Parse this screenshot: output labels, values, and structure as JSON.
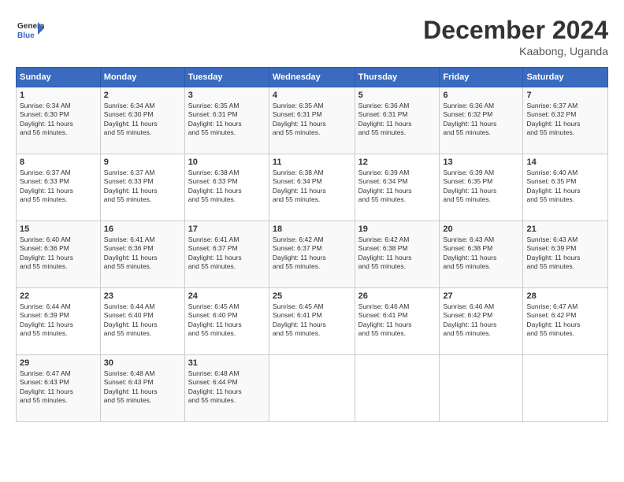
{
  "logo": {
    "line1": "General",
    "line2": "Blue"
  },
  "title": "December 2024",
  "subtitle": "Kaabong, Uganda",
  "weekdays": [
    "Sunday",
    "Monday",
    "Tuesday",
    "Wednesday",
    "Thursday",
    "Friday",
    "Saturday"
  ],
  "weeks": [
    [
      {
        "day": "1",
        "info": "Sunrise: 6:34 AM\nSunset: 6:30 PM\nDaylight: 11 hours\nand 56 minutes."
      },
      {
        "day": "2",
        "info": "Sunrise: 6:34 AM\nSunset: 6:30 PM\nDaylight: 11 hours\nand 55 minutes."
      },
      {
        "day": "3",
        "info": "Sunrise: 6:35 AM\nSunset: 6:31 PM\nDaylight: 11 hours\nand 55 minutes."
      },
      {
        "day": "4",
        "info": "Sunrise: 6:35 AM\nSunset: 6:31 PM\nDaylight: 11 hours\nand 55 minutes."
      },
      {
        "day": "5",
        "info": "Sunrise: 6:36 AM\nSunset: 6:31 PM\nDaylight: 11 hours\nand 55 minutes."
      },
      {
        "day": "6",
        "info": "Sunrise: 6:36 AM\nSunset: 6:32 PM\nDaylight: 11 hours\nand 55 minutes."
      },
      {
        "day": "7",
        "info": "Sunrise: 6:37 AM\nSunset: 6:32 PM\nDaylight: 11 hours\nand 55 minutes."
      }
    ],
    [
      {
        "day": "8",
        "info": "Sunrise: 6:37 AM\nSunset: 6:33 PM\nDaylight: 11 hours\nand 55 minutes."
      },
      {
        "day": "9",
        "info": "Sunrise: 6:37 AM\nSunset: 6:33 PM\nDaylight: 11 hours\nand 55 minutes."
      },
      {
        "day": "10",
        "info": "Sunrise: 6:38 AM\nSunset: 6:33 PM\nDaylight: 11 hours\nand 55 minutes."
      },
      {
        "day": "11",
        "info": "Sunrise: 6:38 AM\nSunset: 6:34 PM\nDaylight: 11 hours\nand 55 minutes."
      },
      {
        "day": "12",
        "info": "Sunrise: 6:39 AM\nSunset: 6:34 PM\nDaylight: 11 hours\nand 55 minutes."
      },
      {
        "day": "13",
        "info": "Sunrise: 6:39 AM\nSunset: 6:35 PM\nDaylight: 11 hours\nand 55 minutes."
      },
      {
        "day": "14",
        "info": "Sunrise: 6:40 AM\nSunset: 6:35 PM\nDaylight: 11 hours\nand 55 minutes."
      }
    ],
    [
      {
        "day": "15",
        "info": "Sunrise: 6:40 AM\nSunset: 6:36 PM\nDaylight: 11 hours\nand 55 minutes."
      },
      {
        "day": "16",
        "info": "Sunrise: 6:41 AM\nSunset: 6:36 PM\nDaylight: 11 hours\nand 55 minutes."
      },
      {
        "day": "17",
        "info": "Sunrise: 6:41 AM\nSunset: 6:37 PM\nDaylight: 11 hours\nand 55 minutes."
      },
      {
        "day": "18",
        "info": "Sunrise: 6:42 AM\nSunset: 6:37 PM\nDaylight: 11 hours\nand 55 minutes."
      },
      {
        "day": "19",
        "info": "Sunrise: 6:42 AM\nSunset: 6:38 PM\nDaylight: 11 hours\nand 55 minutes."
      },
      {
        "day": "20",
        "info": "Sunrise: 6:43 AM\nSunset: 6:38 PM\nDaylight: 11 hours\nand 55 minutes."
      },
      {
        "day": "21",
        "info": "Sunrise: 6:43 AM\nSunset: 6:39 PM\nDaylight: 11 hours\nand 55 minutes."
      }
    ],
    [
      {
        "day": "22",
        "info": "Sunrise: 6:44 AM\nSunset: 6:39 PM\nDaylight: 11 hours\nand 55 minutes."
      },
      {
        "day": "23",
        "info": "Sunrise: 6:44 AM\nSunset: 6:40 PM\nDaylight: 11 hours\nand 55 minutes."
      },
      {
        "day": "24",
        "info": "Sunrise: 6:45 AM\nSunset: 6:40 PM\nDaylight: 11 hours\nand 55 minutes."
      },
      {
        "day": "25",
        "info": "Sunrise: 6:45 AM\nSunset: 6:41 PM\nDaylight: 11 hours\nand 55 minutes."
      },
      {
        "day": "26",
        "info": "Sunrise: 6:46 AM\nSunset: 6:41 PM\nDaylight: 11 hours\nand 55 minutes."
      },
      {
        "day": "27",
        "info": "Sunrise: 6:46 AM\nSunset: 6:42 PM\nDaylight: 11 hours\nand 55 minutes."
      },
      {
        "day": "28",
        "info": "Sunrise: 6:47 AM\nSunset: 6:42 PM\nDaylight: 11 hours\nand 55 minutes."
      }
    ],
    [
      {
        "day": "29",
        "info": "Sunrise: 6:47 AM\nSunset: 6:43 PM\nDaylight: 11 hours\nand 55 minutes."
      },
      {
        "day": "30",
        "info": "Sunrise: 6:48 AM\nSunset: 6:43 PM\nDaylight: 11 hours\nand 55 minutes."
      },
      {
        "day": "31",
        "info": "Sunrise: 6:48 AM\nSunset: 6:44 PM\nDaylight: 11 hours\nand 55 minutes."
      },
      null,
      null,
      null,
      null
    ]
  ]
}
